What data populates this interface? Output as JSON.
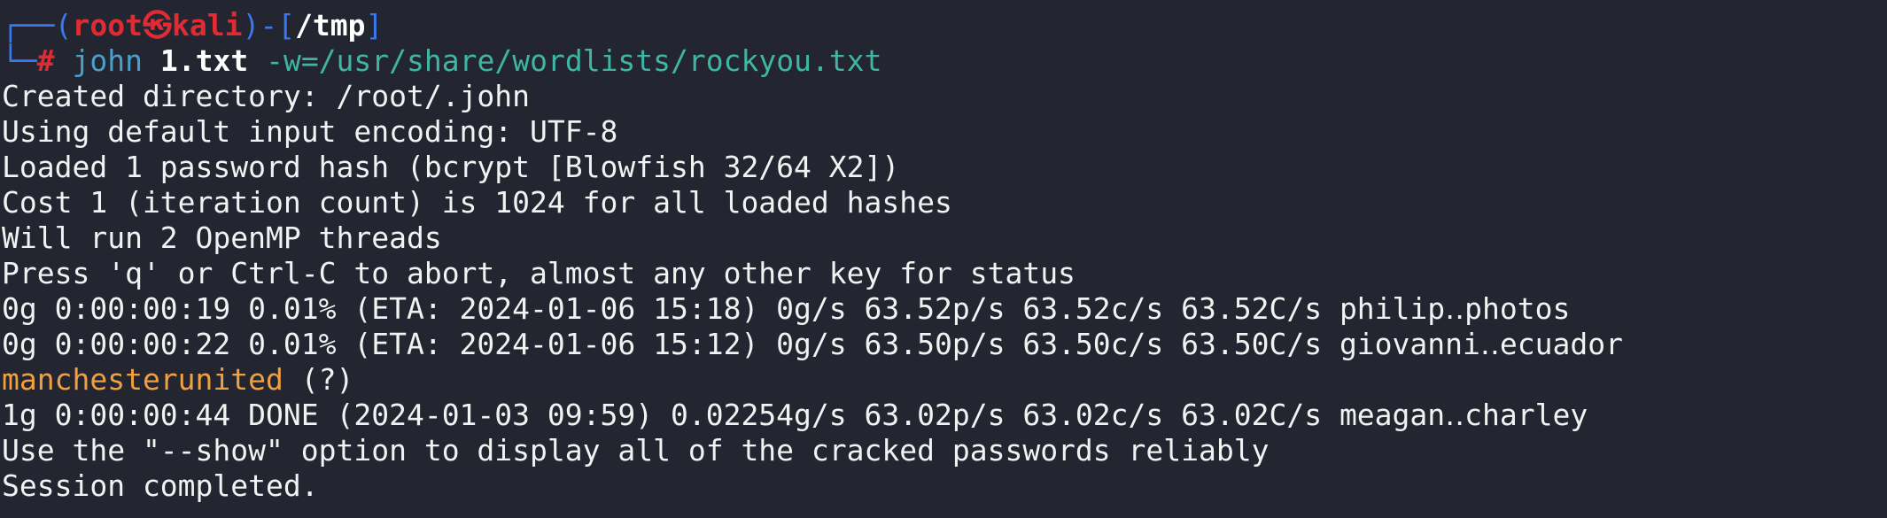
{
  "prompt": {
    "top_left": "┌──",
    "bottom_left": "└─",
    "open_paren": "(",
    "user": "root",
    "skull": "㉿",
    "host": "kali",
    "close_sep": ")-[",
    "cwd": "/tmp",
    "close_bracket": "]",
    "symbol": "#",
    "command": "john",
    "arg_file": "1.txt",
    "arg_option": "-w=/usr/share/wordlists/rockyou.txt"
  },
  "output": [
    "Created directory: /root/.john",
    "Using default input encoding: UTF-8",
    "Loaded 1 password hash (bcrypt [Blowfish 32/64 X2])",
    "Cost 1 (iteration count) is 1024 for all loaded hashes",
    "Will run 2 OpenMP threads",
    "Press 'q' or Ctrl-C to abort, almost any other key for status",
    "0g 0:00:00:19 0.01% (ETA: 2024-01-06 15:18) 0g/s 63.52p/s 63.52c/s 63.52C/s philip‥photos",
    "0g 0:00:00:22 0.01% (ETA: 2024-01-06 15:12) 0g/s 63.50p/s 63.50c/s 63.50C/s giovanni‥ecuador"
  ],
  "cracked": {
    "password": "manchesterunited",
    "user": "(?)"
  },
  "output_after": [
    "1g 0:00:00:44 DONE (2024-01-03 09:59) 0.02254g/s 63.02p/s 63.02c/s 63.02C/s meagan‥charley",
    "Use the \"--show\" option to display all of the cracked passwords reliably",
    "Session completed."
  ],
  "colors": {
    "background": "#232630",
    "frame_blue": "#3a78f0",
    "user_red": "#e02b35",
    "command_blue": "#4aa0c8",
    "option_teal": "#3fb6a3",
    "cracked_orange": "#f0a040",
    "text": "#f2f2f2"
  }
}
